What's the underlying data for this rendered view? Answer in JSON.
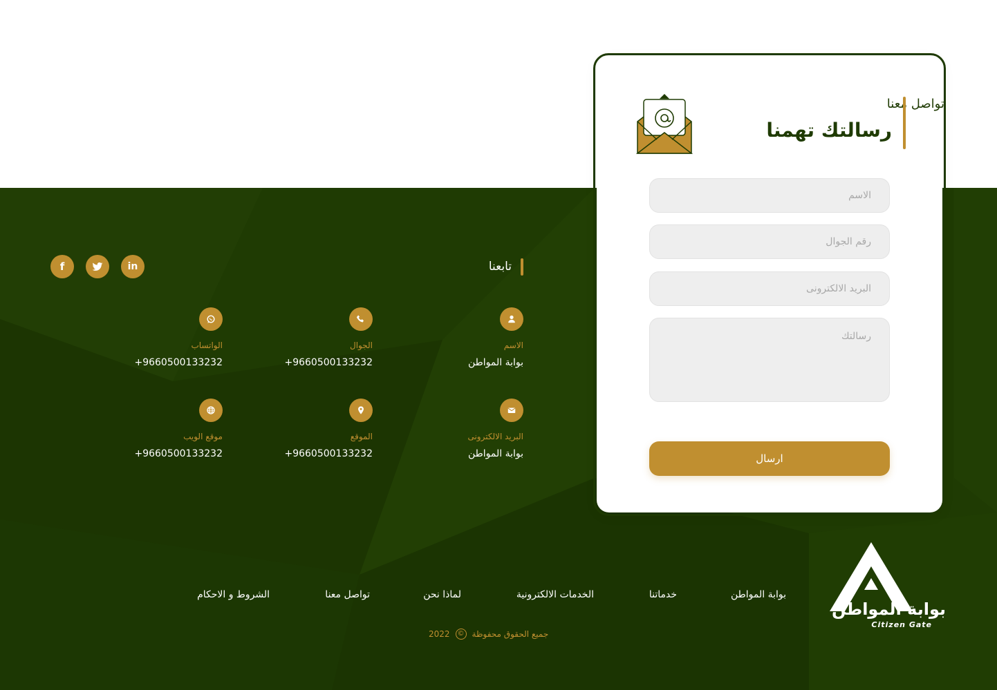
{
  "colors": {
    "primary": "#1f3b03",
    "accent": "#c08f30",
    "background": "#ffffff"
  },
  "form": {
    "subtitle": "تواصل معنا",
    "title": "رسالتك تهمنا",
    "icon": "envelope-at-icon",
    "name_placeholder": "الاسم",
    "phone_placeholder": "رقم الجوال",
    "email_placeholder": "البريد الالكترونى",
    "message_placeholder": "رسالتك",
    "submit_label": "ارسال"
  },
  "follow": {
    "title": "تابعنا",
    "social": [
      {
        "name": "linkedin",
        "icon": "linkedin-icon",
        "glyph": "in"
      },
      {
        "name": "twitter",
        "icon": "twitter-icon"
      },
      {
        "name": "facebook",
        "icon": "facebook-icon",
        "glyph": "f"
      }
    ]
  },
  "contact_info": [
    {
      "icon": "user-icon",
      "label": "الاسم",
      "value": "بوابة المواطن"
    },
    {
      "icon": "phone-icon",
      "label": "الجوال",
      "value": "+9660500133232"
    },
    {
      "icon": "whatsapp-icon",
      "label": "الواتساب",
      "value": "+9660500133232"
    },
    {
      "icon": "envelope-icon",
      "label": "البريد الالكترونى",
      "value": "بوابة المواطن"
    },
    {
      "icon": "location-pin-icon",
      "label": "الموقع",
      "value": "+9660500133232"
    },
    {
      "icon": "globe-icon",
      "label": "موقع الويب",
      "value": "+9660500133232"
    }
  ],
  "footer": {
    "nav": [
      "بوابة المواطن",
      "خدماتنا",
      "الخدمات الالكترونية",
      "لماذا نحن",
      "تواصل معنا",
      "الشروط و الاحكام"
    ],
    "copyright_text": "جميع الحقوق محفوظة",
    "copyright_symbol": "©",
    "copyright_year": "2022",
    "logo_name": "بوابة المواطن",
    "logo_subtitle": "Citizen Gate"
  }
}
